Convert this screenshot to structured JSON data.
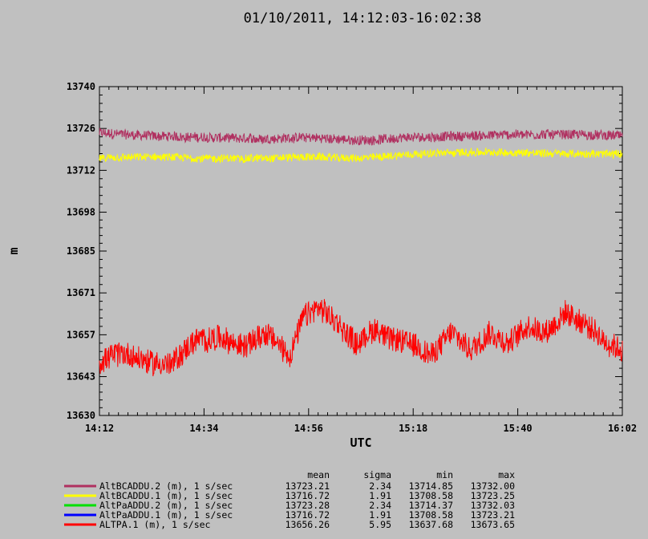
{
  "chart_data": {
    "type": "line",
    "title": "01/10/2011, 14:12:03-16:02:38",
    "xlabel": "UTC",
    "ylabel": "m",
    "x_ticks": [
      "14:12",
      "14:34",
      "14:56",
      "15:18",
      "15:40",
      "16:02"
    ],
    "y_ticks": [
      13630,
      13643,
      13657,
      13671,
      13685,
      13698,
      13712,
      13726,
      13740
    ],
    "xlim": [
      "14:12",
      "16:02"
    ],
    "ylim": [
      13630,
      13740
    ],
    "grid": false,
    "legend_position": "bottom",
    "stats_headers": [
      "mean",
      "sigma",
      "min",
      "max"
    ],
    "series": [
      {
        "name": "AltBCADDU.2 (m), 1 s/sec",
        "color": "#b03060",
        "stats": [
          "13723.21",
          "2.34",
          "13714.85",
          "13732.00"
        ],
        "mean": 13723.21,
        "sigma": 2.34,
        "min": 13714.85,
        "max": 13732.0,
        "x": [
          "14:12",
          "14:23",
          "14:34",
          "14:45",
          "14:56",
          "15:07",
          "15:18",
          "15:29",
          "15:40",
          "15:51",
          "16:02"
        ],
        "y": [
          13724.5,
          13723.5,
          13723.0,
          13722.5,
          13723.0,
          13722.0,
          13723.0,
          13723.5,
          13724.0,
          13724.0,
          13723.5
        ]
      },
      {
        "name": "AltBCADDU.1 (m), 1 s/sec",
        "color": "#ffff00",
        "stats": [
          "13716.72",
          "1.91",
          "13708.58",
          "13723.25"
        ],
        "mean": 13716.72,
        "sigma": 1.91,
        "min": 13708.58,
        "max": 13723.25,
        "x": [
          "14:12",
          "14:23",
          "14:34",
          "14:45",
          "14:56",
          "15:07",
          "15:18",
          "15:29",
          "15:40",
          "15:51",
          "16:02"
        ],
        "y": [
          13716.0,
          13716.5,
          13716.0,
          13716.0,
          13716.5,
          13716.0,
          13717.5,
          13718.0,
          13718.0,
          13717.5,
          13717.5
        ]
      },
      {
        "name": "AltPaADDU.2 (m), 1 s/sec",
        "color": "#00e000",
        "stats": [
          "13723.28",
          "2.34",
          "13714.37",
          "13732.03"
        ],
        "mean": 13723.28,
        "sigma": 2.34,
        "min": 13714.37,
        "max": 13732.03
      },
      {
        "name": "AltPaADDU.1 (m), 1 s/sec",
        "color": "#0000ff",
        "stats": [
          "13716.72",
          "1.91",
          "13708.58",
          "13723.21"
        ],
        "mean": 13716.72,
        "sigma": 1.91,
        "min": 13708.58,
        "max": 13723.21
      },
      {
        "name": "ALTPA.1 (m), 1 s/sec",
        "color": "#ff0000",
        "stats": [
          "13656.26",
          "5.95",
          "13637.68",
          "13673.65"
        ],
        "mean": 13656.26,
        "sigma": 5.95,
        "min": 13637.68,
        "max": 13673.65,
        "x": [
          "14:12",
          "14:17",
          "14:22",
          "14:27",
          "14:32",
          "14:37",
          "14:42",
          "14:47",
          "14:52",
          "14:55",
          "14:58",
          "15:02",
          "15:06",
          "15:10",
          "15:14",
          "15:18",
          "15:22",
          "15:26",
          "15:30",
          "15:34",
          "15:38",
          "15:42",
          "15:46",
          "15:50",
          "15:54",
          "15:58",
          "16:02"
        ],
        "y": [
          13648,
          13651,
          13648,
          13647,
          13655,
          13656,
          13653,
          13658,
          13650,
          13663,
          13666,
          13661,
          13654,
          13659,
          13655,
          13654,
          13650,
          13658,
          13652,
          13658,
          13654,
          13660,
          13658,
          13664,
          13661,
          13655,
          13652
        ]
      }
    ]
  }
}
